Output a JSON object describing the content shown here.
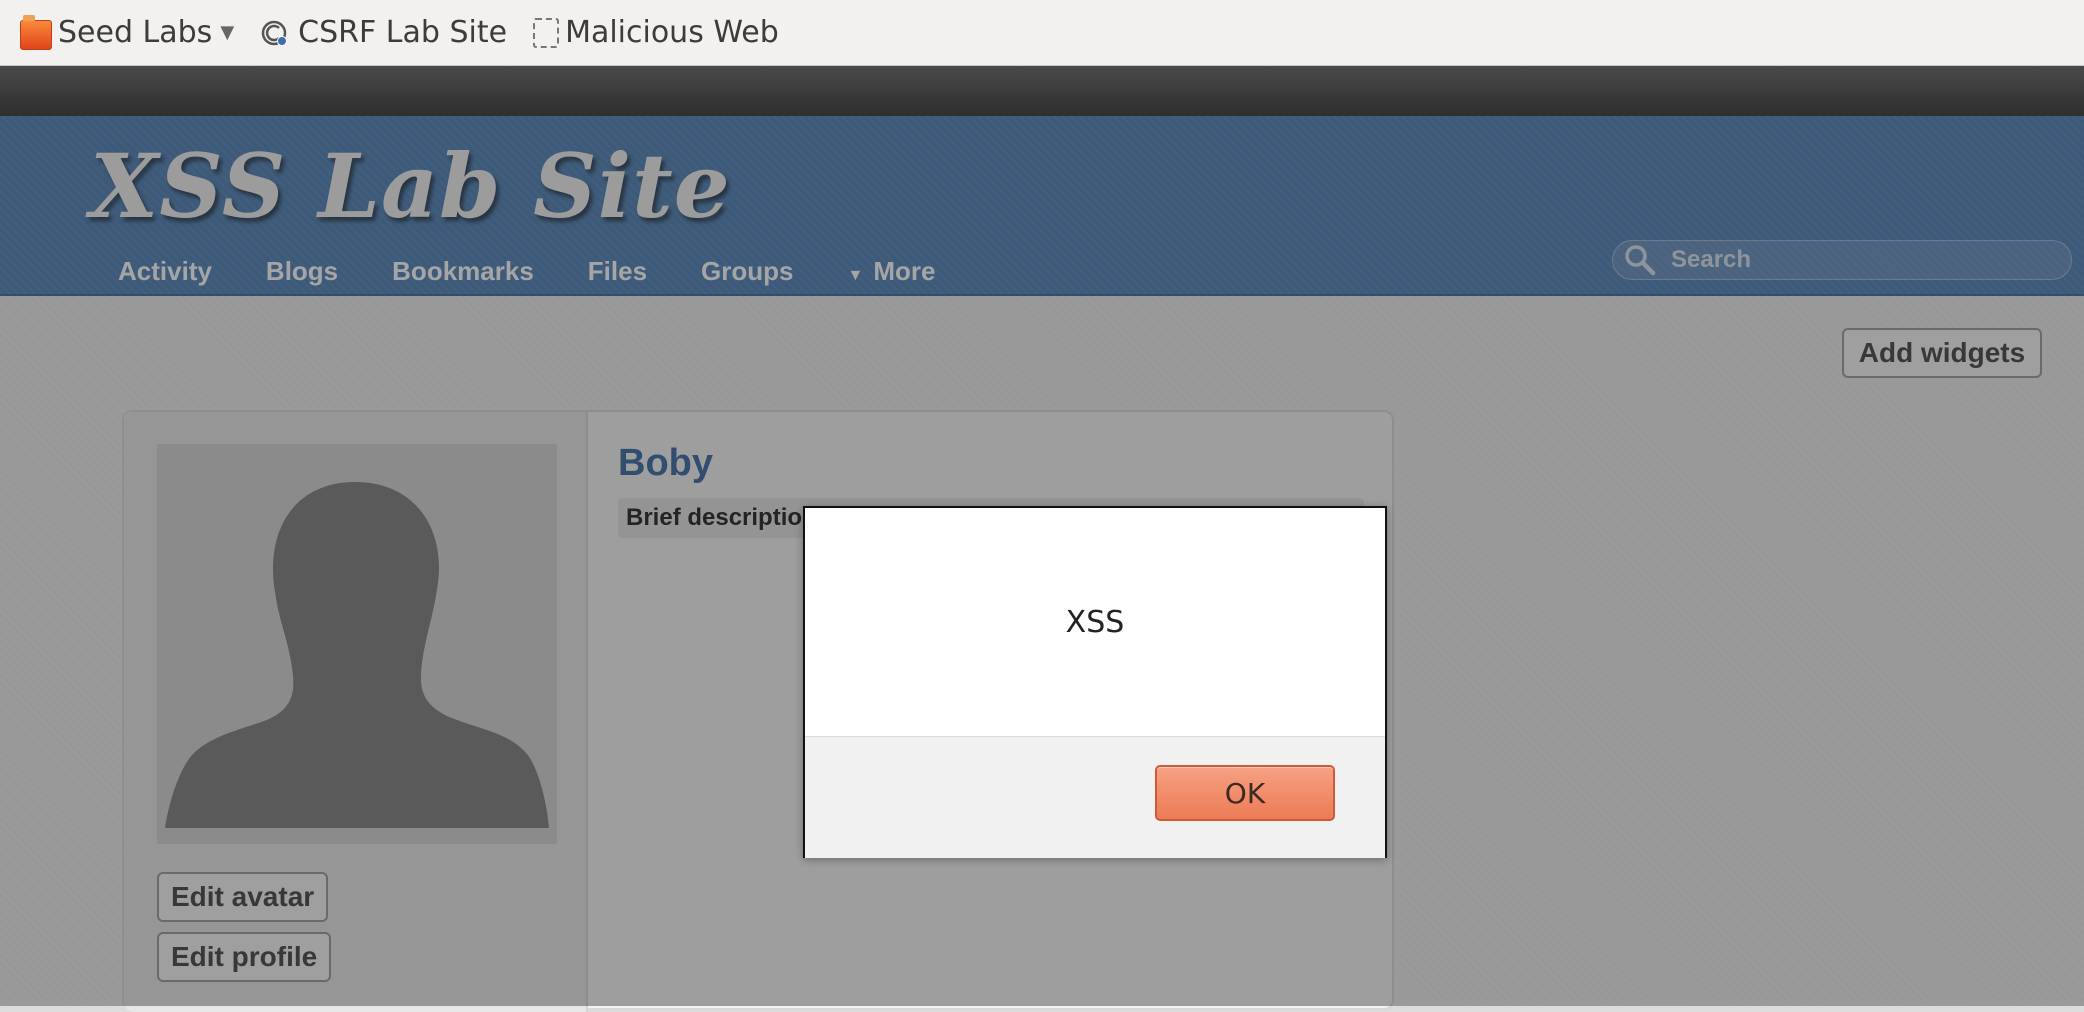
{
  "bookmarks": {
    "items": [
      {
        "label": "Seed Labs",
        "icon": "folder-icon",
        "has_dropdown": true
      },
      {
        "label": "CSRF Lab Site",
        "icon": "csrf-site-icon"
      },
      {
        "label": "Malicious Web",
        "icon": "blank-page-icon"
      }
    ]
  },
  "site": {
    "title": "XSS Lab Site",
    "nav": [
      {
        "label": "Activity"
      },
      {
        "label": "Blogs"
      },
      {
        "label": "Bookmarks"
      },
      {
        "label": "Files"
      },
      {
        "label": "Groups"
      },
      {
        "label": "More",
        "icon": "triangle-down-icon"
      }
    ],
    "search_placeholder": "Search",
    "accent_color": "#4f7fb5"
  },
  "profile": {
    "add_widgets_label": "Add widgets",
    "name": "Boby",
    "brief_description_label": "Brief descriptio",
    "edit_avatar_label": "Edit avatar",
    "edit_profile_label": "Edit profile"
  },
  "dialog": {
    "message": "XSS",
    "ok_label": "OK",
    "ok_color": "#ec7b55"
  }
}
